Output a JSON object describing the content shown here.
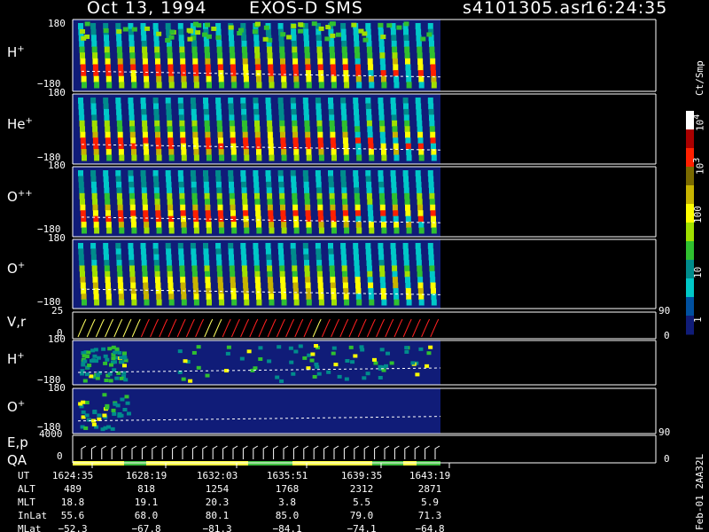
{
  "header": {
    "date": "Oct 13, 1994",
    "instrument": "EXOS-D SMS",
    "file": "s4101305.asr",
    "time": "16:24:35"
  },
  "colorbar": {
    "title": "Ct/Smp",
    "labels": [
      "10^4",
      "10^3",
      "100",
      "10",
      "1"
    ],
    "colors": [
      "#ffffff",
      "#aa0000",
      "#ff2000",
      "#7a6a00",
      "#c8b400",
      "#ffff00",
      "#a0e000",
      "#30c030",
      "#008c8c",
      "#00c8c8",
      "#0050a0",
      "#101c78"
    ]
  },
  "panels": [
    {
      "id": "hplus",
      "label": "H",
      "sup": "+",
      "top_tick": "180",
      "bottom_tick": "−180"
    },
    {
      "id": "heplus",
      "label": "He",
      "sup": "+",
      "top_tick": "180",
      "bottom_tick": "−180"
    },
    {
      "id": "oplusplus",
      "label": "O",
      "sup": "++",
      "top_tick": "180",
      "bottom_tick": "−180"
    },
    {
      "id": "oplus",
      "label": "O",
      "sup": "+",
      "top_tick": "180",
      "bottom_tick": "−180"
    },
    {
      "id": "vr",
      "label": "V,r",
      "sup": "",
      "top_tick": "25",
      "bottom_tick": "0",
      "right_top": "90",
      "right_bottom": "0"
    },
    {
      "id": "hplus2",
      "label": "H",
      "sup": "+",
      "top_tick": "180",
      "bottom_tick": "−180"
    },
    {
      "id": "oplus2",
      "label": "O",
      "sup": "+",
      "top_tick": "180",
      "bottom_tick": "−180"
    },
    {
      "id": "ep",
      "label": "E,p",
      "label2": "QA",
      "sup": "",
      "top_tick": "4000",
      "bottom_tick": "0",
      "right_top": "90",
      "right_bottom": "0"
    }
  ],
  "footer": {
    "row_labels": [
      "UT",
      "ALT",
      "MLT",
      "InLat",
      "MLat"
    ],
    "columns": [
      [
        "1624:35",
        "489",
        "18.8",
        "55.6",
        "−52.3"
      ],
      [
        "1628:19",
        "818",
        "19.1",
        "68.0",
        "−67.8"
      ],
      [
        "1632:03",
        "1254",
        "20.3",
        "80.1",
        "−81.3"
      ],
      [
        "1635:51",
        "1768",
        "3.8",
        "85.0",
        "−84.1"
      ],
      [
        "1639:35",
        "2312",
        "5.5",
        "79.0",
        "−74.1"
      ],
      [
        "1643:19",
        "2871",
        "5.9",
        "71.3",
        "−64.8"
      ]
    ],
    "stamp": "Feb-01 2AA32L"
  },
  "chart_data": {
    "type": "heatmap",
    "title": "Oct 13, 1994 EXOS-D SMS",
    "x_tick_labels": [
      "1624:35",
      "1628:19",
      "1632:03",
      "1635:51",
      "1639:35",
      "1643:19"
    ],
    "y_range_pitch": [
      -180,
      180
    ],
    "colorbar_unit": "Ct/Smp",
    "colorbar_range": [
      1,
      10000
    ],
    "colorbar_scale": "log"
  }
}
